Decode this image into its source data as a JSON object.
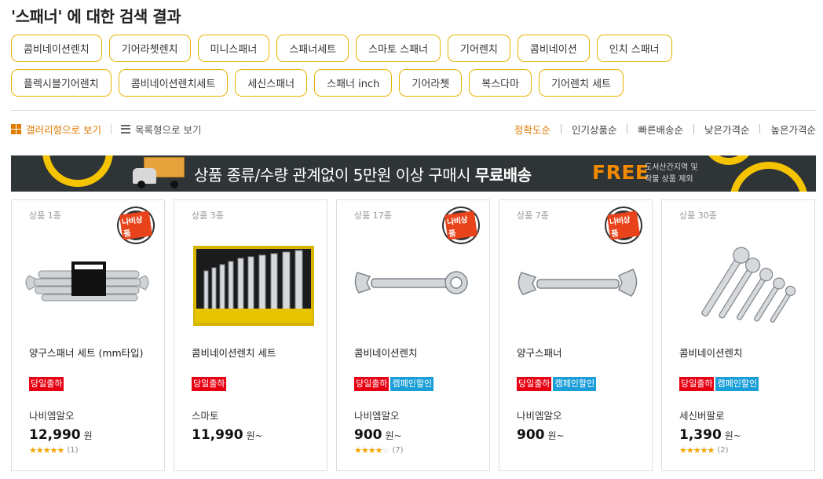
{
  "search": {
    "title": "'스패너' 에 대한 검색 결과"
  },
  "tags": {
    "row1": [
      "콤비네이션렌치",
      "기어라쳇렌치",
      "미니스패너",
      "스패너세트",
      "스마토 스패너",
      "기어렌치",
      "콤비네이션",
      "인치 스패너"
    ],
    "row2": [
      "플렉시블기어렌치",
      "콤비네이션렌치세트",
      "세신스패너",
      "스패너 inch",
      "기어라쳇",
      "복스다마",
      "기어렌치 세트"
    ]
  },
  "view": {
    "gallery_label": "갤러리형으로 보기",
    "list_label": "목록형으로 보기"
  },
  "sort": {
    "options": [
      "정확도순",
      "인기상품순",
      "빠른배송순",
      "낮은가격순",
      "높은가격순"
    ],
    "active": "정확도순"
  },
  "banner": {
    "text_prefix": "상품 종류/수량 관계없이 5만원 이상 구매시 ",
    "text_bold": "무료배송",
    "free": "FREE",
    "note_line1": "도서산간지역 및",
    "note_line2": "착불 상품 제외"
  },
  "badge_label": "나비상품",
  "colors": {
    "accent": "#e07b00",
    "tag_border": "#e8b400",
    "banner_bg": "#2f3437",
    "chip_red": "#e60012",
    "chip_blue": "#1a9ed8"
  },
  "products": [
    {
      "count": "상품 1종",
      "name": "양구스패너 세트 (mm타입)",
      "chips": [
        "당일출하"
      ],
      "seller": "나비엠알오",
      "price": "12,990",
      "unit": "원",
      "rating": 5,
      "reviews": "(1)",
      "badge": true,
      "image": "wrench-set-boxed-icon"
    },
    {
      "count": "상품 3종",
      "name": "콤비네이션렌치 세트",
      "chips": [
        "당일출하"
      ],
      "seller": "스마토",
      "price": "11,990",
      "unit": "원~",
      "rating": null,
      "reviews": "",
      "badge": false,
      "image": "wrench-pouch-set-icon"
    },
    {
      "count": "상품 17종",
      "name": "콤비네이션렌치",
      "chips": [
        "당일출하",
        "캠페인할인"
      ],
      "seller": "나비엠알오",
      "price": "900",
      "unit": "원~",
      "rating": 4,
      "reviews": "(7)",
      "badge": true,
      "image": "combination-wrench-icon"
    },
    {
      "count": "상품 7종",
      "name": "양구스패너",
      "chips": [
        "당일출하",
        "캠페인할인"
      ],
      "seller": "나비엠알오",
      "price": "900",
      "unit": "원~",
      "rating": null,
      "reviews": "",
      "badge": true,
      "image": "open-end-wrench-icon"
    },
    {
      "count": "상품 30종",
      "name": "콤비네이션렌치",
      "chips": [
        "당일출하",
        "캠페인할인"
      ],
      "seller": "세신버팔로",
      "price": "1,390",
      "unit": "원~",
      "rating": 5,
      "reviews": "(2)",
      "badge": false,
      "image": "wrench-fan-icon"
    }
  ]
}
